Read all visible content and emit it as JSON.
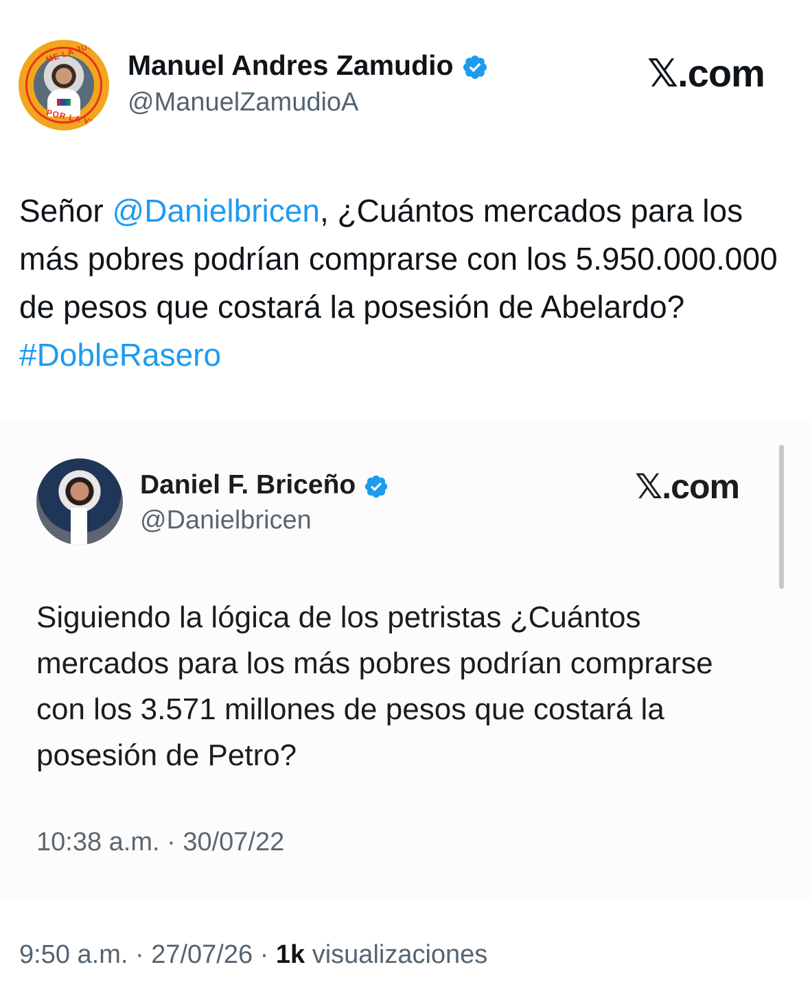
{
  "outer_tweet": {
    "author_name": "Manuel Andres Zamudio",
    "handle": "@ManuelZamudioA",
    "site": "𝕏.com",
    "avatar_badge_top": "ME LA JUEGO",
    "avatar_badge_bottom": "POR LA VIDA",
    "text_part1": "Señor ",
    "mention": "@Danielbricen",
    "text_part2": ", ¿Cuántos mercados para los más pobres podrían comprarse con los 5.950.000.000 de pesos que costará la posesión de Abelardo? ",
    "hashtag": "#DobleRasero",
    "footer_time": "9:50 a.m. · 27/07/26 · ",
    "footer_views_count": "1k",
    "footer_views_label": " visualizaciones"
  },
  "quoted_tweet": {
    "author_name": "Daniel F. Briceño",
    "handle": "@Danielbricen",
    "site": "𝕏.com",
    "text": "Siguiendo la lógica de los petristas ¿Cuántos mercados para los más pobres podrían comprarse con los 3.571 millones de pesos que costará la posesión de Petro?",
    "timestamp": "10:38 a.m. · 30/07/22"
  },
  "colors": {
    "link": "#1d9bf0",
    "verified": "#1d9bf0",
    "secondary_text": "#536471",
    "badge_orange": "#f2a51d"
  },
  "icons": {
    "verified": "verified-badge-icon"
  }
}
